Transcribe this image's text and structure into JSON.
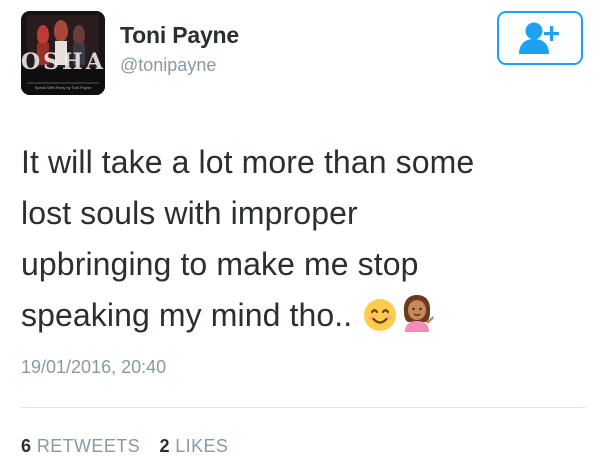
{
  "user": {
    "name": "Toni Payne",
    "handle": "@tonipayne",
    "avatar_text": "OSHA",
    "avatar_caption": "Speak Well Party by Toni Payne"
  },
  "follow_button": {
    "icon": "add-user-icon",
    "color": "#1da1f2"
  },
  "tweet": {
    "lines": [
      "It will take a lot more than some",
      "lost souls with improper",
      "upbringing to make me stop",
      "speaking my mind tho.."
    ],
    "emojis": [
      "smiling-face-icon",
      "information-desk-person-icon"
    ],
    "timestamp": "19/01/2016, 20:40"
  },
  "stats": {
    "retweets_count": "6",
    "retweets_label": "RETWEETS",
    "likes_count": "2",
    "likes_label": "LIKES"
  },
  "colors": {
    "text": "#292f33",
    "muted": "#8899a6",
    "accent": "#1da1f2",
    "divider": "#e1e8ed"
  }
}
